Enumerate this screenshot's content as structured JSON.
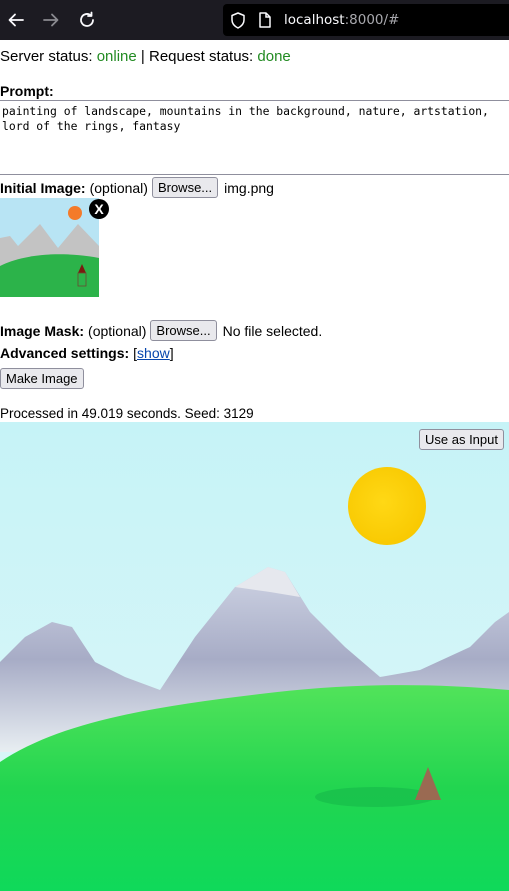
{
  "browser": {
    "url_host": "localhost",
    "url_rest": ":8000/#"
  },
  "status": {
    "server_label": "Server status: ",
    "server_value": "online",
    "separator": " | ",
    "request_label": "Request status: ",
    "request_value": "done"
  },
  "prompt": {
    "label": "Prompt:",
    "value": "painting of landscape, mountains in the background, nature, artstation, lord of the rings, fantasy"
  },
  "initial_image": {
    "label": "Initial Image:",
    "optional": "(optional)",
    "browse_label": "Browse...",
    "file_name": "img.png",
    "remove_label": "X"
  },
  "image_mask": {
    "label": "Image Mask:",
    "optional": "(optional)",
    "browse_label": "Browse...",
    "file_name": "No file selected."
  },
  "advanced": {
    "label": "Advanced settings:",
    "bracket_open": "[",
    "link": "show",
    "bracket_close": "]"
  },
  "make_image_label": "Make Image",
  "result": {
    "info": "Processed in 49.019 seconds. Seed: 3129",
    "use_as_input_label": "Use as Input"
  },
  "colors": {
    "status_green": "#228b22",
    "link_blue": "#0645ad",
    "toolbar_bg": "#1c1b22"
  }
}
